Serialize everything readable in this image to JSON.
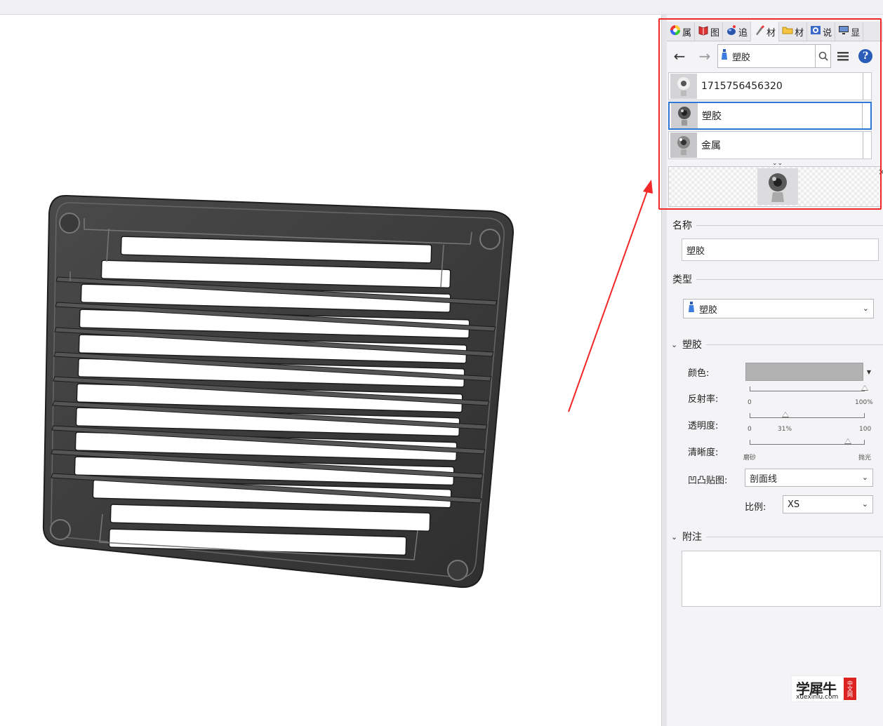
{
  "tabs": [
    {
      "label": "属",
      "icon": "color-wheel-icon"
    },
    {
      "label": "图",
      "icon": "book-icon"
    },
    {
      "label": "追",
      "icon": "teapot-icon"
    },
    {
      "label": "材",
      "icon": "brush-icon"
    },
    {
      "label": "材",
      "icon": "folder-icon"
    },
    {
      "label": "说",
      "icon": "tutorial-icon"
    },
    {
      "label": "显",
      "icon": "monitor-icon"
    }
  ],
  "nav": {
    "path_label": "塑胶"
  },
  "materials": [
    {
      "name": "1715756456320",
      "selected": false
    },
    {
      "name": "塑胶",
      "selected": true
    },
    {
      "name": "金属",
      "selected": false
    }
  ],
  "sections": {
    "name_header": "名称",
    "name_value": "塑胶",
    "type_header": "类型",
    "type_value": "塑胶",
    "plastic_header": "塑胶",
    "notes_header": "附注"
  },
  "properties": {
    "color_label": "颜色:",
    "color_value": "#b2b2b2",
    "reflect_label": "反射率:",
    "reflect_min": "0",
    "reflect_max": "100%",
    "reflect_value": 100,
    "transp_label": "透明度:",
    "transp_min": "0",
    "transp_mid": "31%",
    "transp_max": "100",
    "transp_value": 31,
    "clarity_label": "清晰度:",
    "clarity_min": "磨砂",
    "clarity_max": "抛光",
    "clarity_value": 85,
    "bump_label": "凹凸贴图:",
    "bump_value": "剖面线",
    "scale_label": "比例:",
    "scale_value": "XS"
  },
  "watermark": {
    "big": "学犀牛",
    "small": "xuexiniu.com",
    "stamp": "中文网"
  }
}
